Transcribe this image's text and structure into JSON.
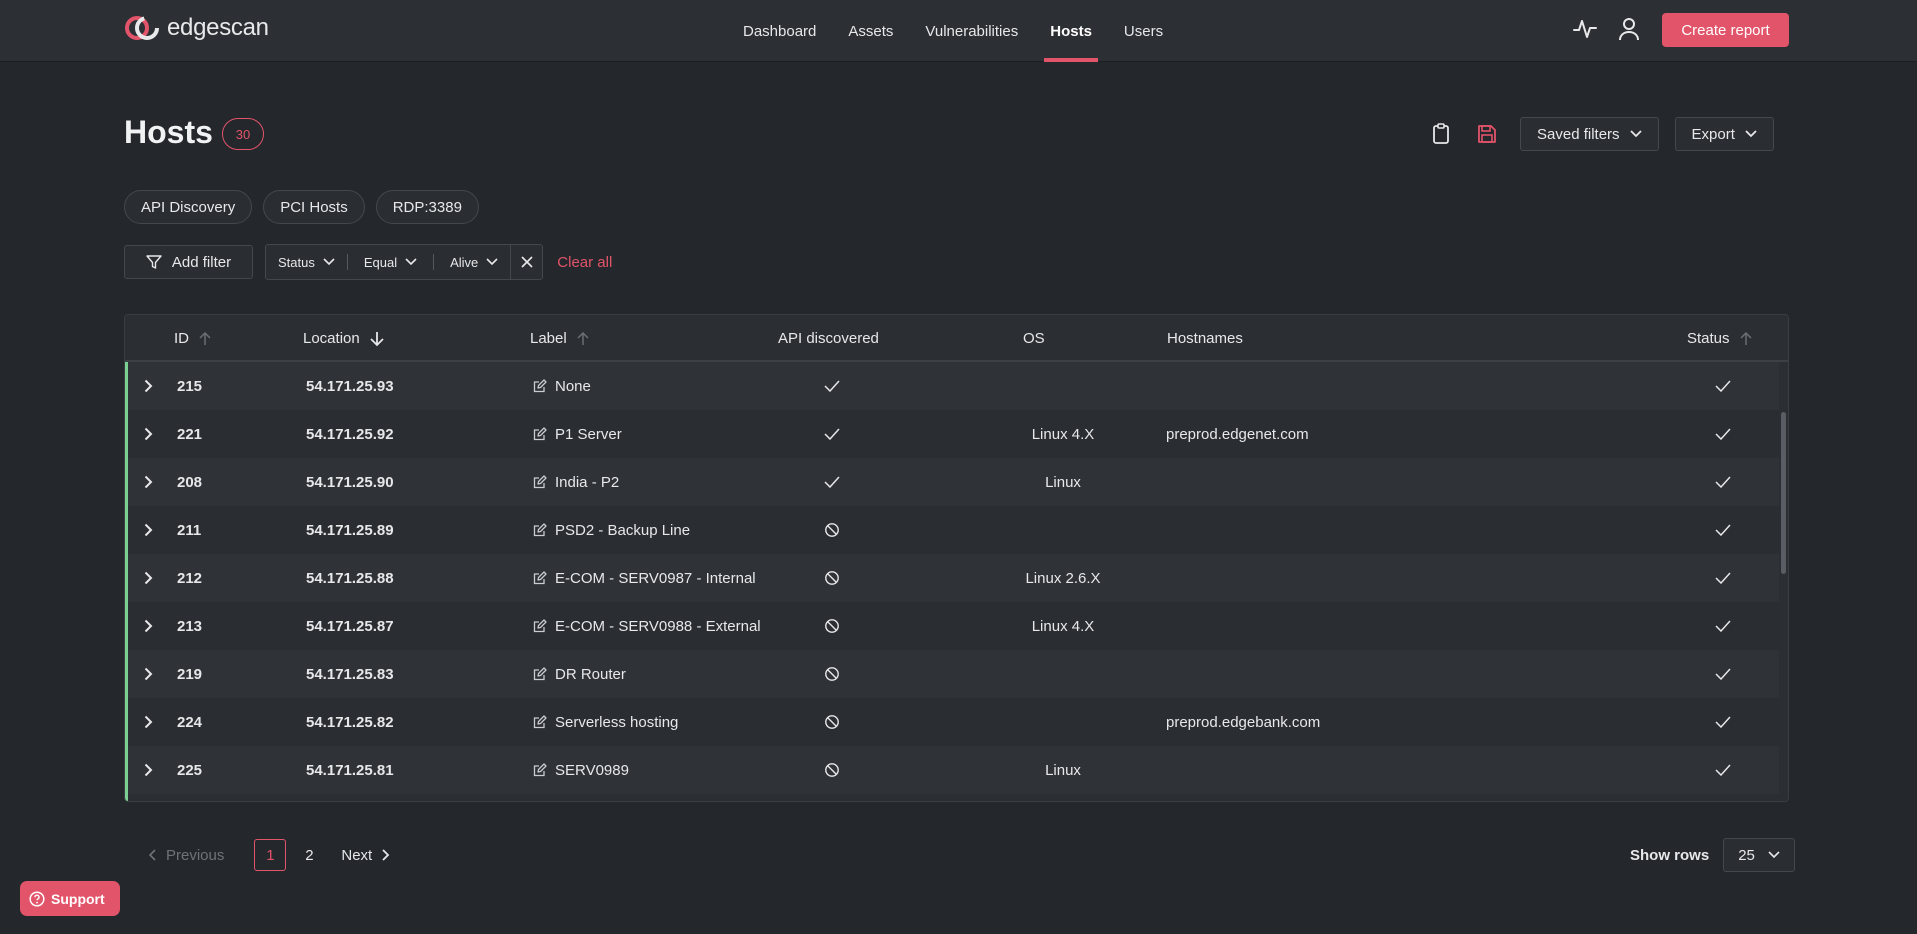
{
  "app": {
    "brand": "edgescan",
    "accent": "#e2546a",
    "status_bar_color": "#7ccf92"
  },
  "nav": {
    "items": [
      {
        "label": "Dashboard",
        "active": false
      },
      {
        "label": "Assets",
        "active": false
      },
      {
        "label": "Vulnerabilities",
        "active": false
      },
      {
        "label": "Hosts",
        "active": true
      },
      {
        "label": "Users",
        "active": false
      }
    ],
    "icons": [
      "activity-icon",
      "user-icon"
    ],
    "create_report": "Create report"
  },
  "page": {
    "title": "Hosts",
    "count": "30",
    "actions": {
      "icons": [
        "clipboard-icon",
        "save-icon"
      ],
      "saved_filters": "Saved filters",
      "export": "Export"
    }
  },
  "chips": [
    "API Discovery",
    "PCI Hosts",
    "RDP:3389"
  ],
  "filters": {
    "add_filter": "Add filter",
    "active": {
      "field": "Status",
      "operator": "Equal",
      "value": "Alive"
    },
    "clear_all": "Clear all"
  },
  "table": {
    "columns": {
      "id": "ID",
      "location": "Location",
      "label": "Label",
      "api": "API discovered",
      "os": "OS",
      "hostnames": "Hostnames",
      "status": "Status"
    },
    "sort": {
      "column": "location",
      "direction": "desc"
    },
    "rows": [
      {
        "id": "215",
        "location": "54.171.25.93",
        "label": "None",
        "api": true,
        "os": "",
        "hostnames": "",
        "status": true
      },
      {
        "id": "221",
        "location": "54.171.25.92",
        "label": "P1 Server",
        "api": true,
        "os": "Linux 4.X",
        "hostnames": "preprod.edgenet.com",
        "status": true
      },
      {
        "id": "208",
        "location": "54.171.25.90",
        "label": "India - P2",
        "api": true,
        "os": "Linux",
        "hostnames": "",
        "status": true
      },
      {
        "id": "211",
        "location": "54.171.25.89",
        "label": "PSD2 - Backup Line",
        "api": false,
        "os": "",
        "hostnames": "",
        "status": true
      },
      {
        "id": "212",
        "location": "54.171.25.88",
        "label": "E-COM - SERV0987 - Internal",
        "api": false,
        "os": "Linux 2.6.X",
        "hostnames": "",
        "status": true
      },
      {
        "id": "213",
        "location": "54.171.25.87",
        "label": "E-COM - SERV0988 - External",
        "api": false,
        "os": "Linux 4.X",
        "hostnames": "",
        "status": true
      },
      {
        "id": "219",
        "location": "54.171.25.83",
        "label": "DR Router",
        "api": false,
        "os": "",
        "hostnames": "",
        "status": true
      },
      {
        "id": "224",
        "location": "54.171.25.82",
        "label": "Serverless hosting",
        "api": false,
        "os": "",
        "hostnames": "preprod.edgebank.com",
        "status": true
      },
      {
        "id": "225",
        "location": "54.171.25.81",
        "label": "SERV0989",
        "api": false,
        "os": "Linux",
        "hostnames": "",
        "status": true
      }
    ]
  },
  "pagination": {
    "previous": "Previous",
    "pages": [
      "1",
      "2"
    ],
    "current": "1",
    "next": "Next",
    "show_rows_label": "Show rows",
    "rows_per_page": "25"
  },
  "support": {
    "label": "Support"
  }
}
